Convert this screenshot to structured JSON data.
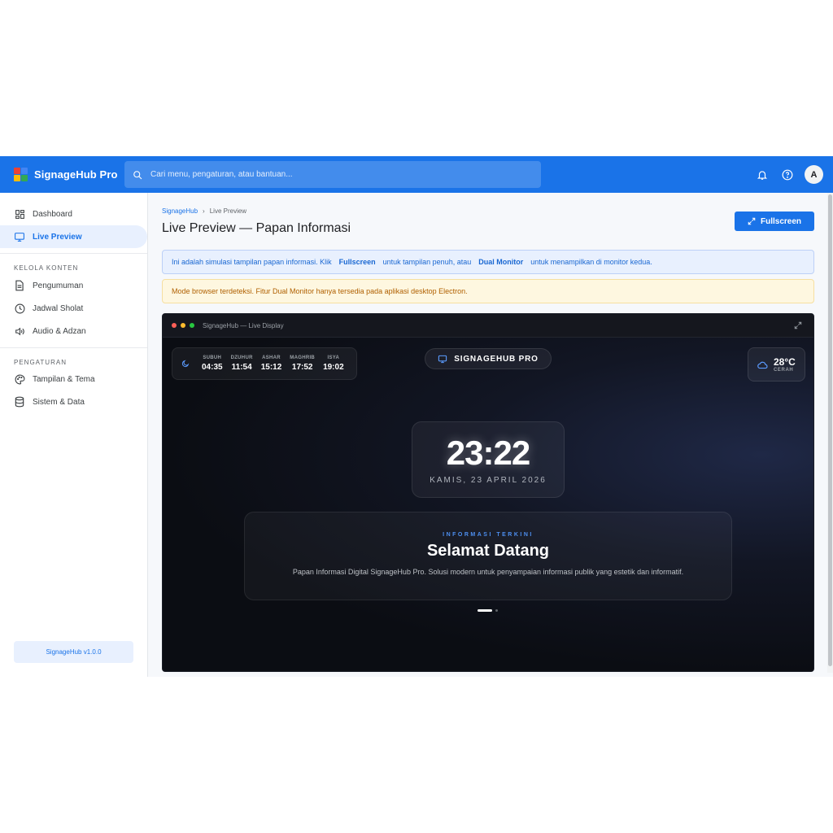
{
  "app": {
    "title": "SignageHub Pro",
    "logo_colors": [
      "#ea4335",
      "#4285f4",
      "#fbbc05",
      "#34a853"
    ]
  },
  "search": {
    "placeholder": "Cari menu, pengaturan, atau bantuan..."
  },
  "topbar": {
    "avatar_initial": "A",
    "icons": [
      "bell-icon",
      "help-icon"
    ]
  },
  "sidebar": {
    "items": [
      {
        "label": "Dashboard",
        "icon": "dashboard-icon"
      },
      {
        "label": "Live Preview",
        "icon": "monitor-icon",
        "active": true
      }
    ],
    "section_content": "KELOLA KONTEN",
    "content_items": [
      {
        "label": "Pengumuman",
        "icon": "document-icon"
      },
      {
        "label": "Jadwal Sholat",
        "icon": "clock-icon"
      },
      {
        "label": "Audio & Adzan",
        "icon": "speaker-icon"
      }
    ],
    "section_settings": "PENGATURAN",
    "settings_items": [
      {
        "label": "Tampilan & Tema",
        "icon": "palette-icon"
      },
      {
        "label": "Sistem & Data",
        "icon": "database-icon"
      }
    ],
    "version": "SignageHub v1.0.0"
  },
  "main": {
    "breadcrumb": [
      "SignageHub",
      "Live Preview"
    ],
    "title": "Live Preview — Papan Informasi",
    "fullscreen_label": "Fullscreen",
    "info_banner": {
      "part1": "Ini adalah simulasi tampilan papan informasi. Klik",
      "bold1": "Fullscreen",
      "part2": "untuk tampilan penuh, atau",
      "bold2": "Dual Monitor",
      "part3": "untuk menampilkan di monitor kedua."
    },
    "warning_banner": "Mode browser terdeteksi. Fitur Dual Monitor hanya tersedia pada aplikasi desktop Electron."
  },
  "display": {
    "window_title": "SignageHub — Live Display",
    "prayers": [
      {
        "name": "SUBUH",
        "time": "04:35"
      },
      {
        "name": "DZUHUR",
        "time": "11:54"
      },
      {
        "name": "ASHAR",
        "time": "15:12"
      },
      {
        "name": "MAGHRIB",
        "time": "17:52"
      },
      {
        "name": "ISYA",
        "time": "19:02"
      }
    ],
    "brand": "SIGNAGEHUB PRO",
    "weather": {
      "temp": "28°C",
      "condition": "CERAH"
    },
    "clock": "23:22",
    "date": "KAMIS, 23 APRIL 2026",
    "info": {
      "label": "INFORMASI TERKINI",
      "heading": "Selamat Datang",
      "body": "Papan Informasi Digital SignageHub Pro. Solusi modern untuk penyampaian informasi publik yang estetik dan informatif."
    },
    "pager": {
      "current": 1,
      "total": 2
    }
  }
}
